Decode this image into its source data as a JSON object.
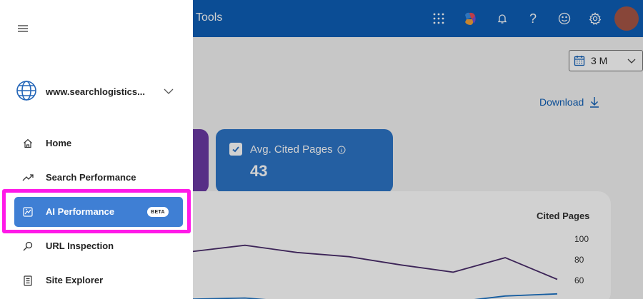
{
  "header": {
    "title": "Tools",
    "icons": [
      "apps-grid-icon",
      "copilot-icon",
      "bell-icon",
      "help-icon",
      "smiley-feedback-icon",
      "gear-icon",
      "avatar"
    ]
  },
  "main": {
    "date_range": "3 M",
    "download_label": "Download",
    "cards": [
      {
        "label": "Avg. Cited Pages",
        "value": "43",
        "checked": true,
        "color": "#2d74c6"
      }
    ],
    "chart": {
      "y_title": "Cited Pages",
      "y_ticks": [
        "100",
        "80",
        "60"
      ]
    }
  },
  "sidebar": {
    "site": "www.searchlogistics...",
    "items": [
      {
        "label": "Home",
        "icon": "home-icon"
      },
      {
        "label": "Search Performance",
        "icon": "trend-icon"
      },
      {
        "label": "AI Performance",
        "icon": "ai-chart-icon",
        "badge": "BETA",
        "active": true
      },
      {
        "label": "URL Inspection",
        "icon": "magnifier-icon"
      },
      {
        "label": "Site Explorer",
        "icon": "document-icon"
      }
    ]
  },
  "colors": {
    "topbar": "#0e5eb6",
    "active_item": "#3f7fd4",
    "highlight": "#ff19e8",
    "purple_card": "#6b3aa4",
    "blue_card": "#2d74c6",
    "line_purple": "#4a2c6b",
    "line_blue": "#1c72c4"
  },
  "chart_data": {
    "type": "line",
    "ylabel": "Cited Pages",
    "ylim": [
      40,
      100
    ],
    "series": [
      {
        "values": [
          88,
          94,
          87,
          83,
          75,
          68,
          82,
          61
        ]
      },
      {
        "values": [
          42,
          43,
          39,
          40,
          40,
          39,
          45,
          47
        ]
      }
    ]
  }
}
